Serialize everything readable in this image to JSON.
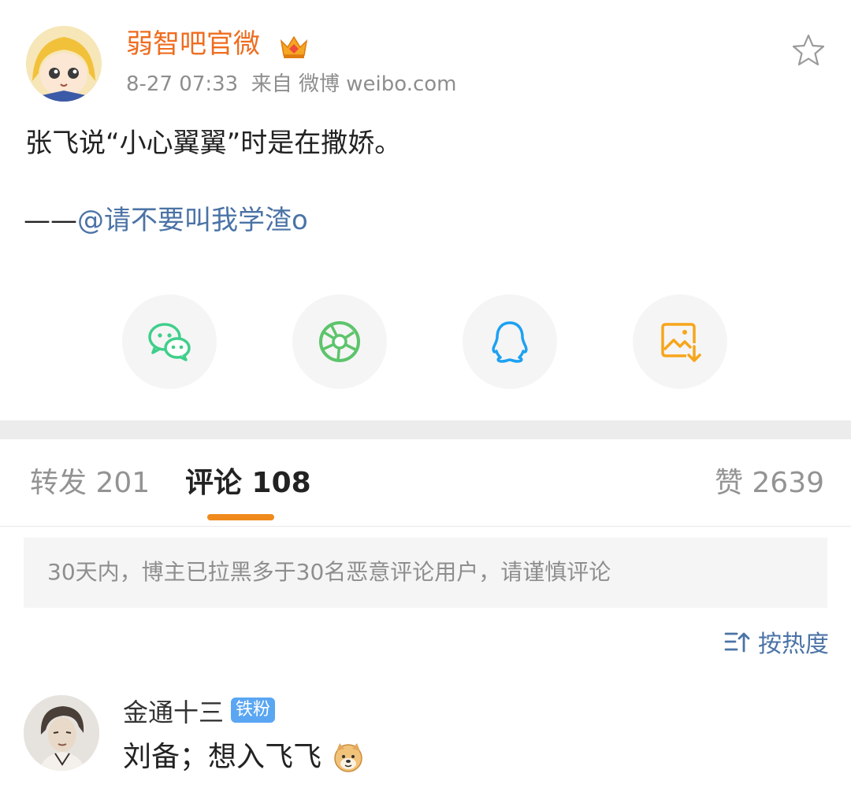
{
  "post": {
    "author": "弱智吧官微",
    "time": "8-27 07:33",
    "source": "来自 微博 weibo.com",
    "text": "张飞说“小心翼翼”时是在撒娇。",
    "byline_dash": "——",
    "byline_mention": "@请不要叫我学渣o"
  },
  "share": {
    "items": [
      {
        "name": "wechat-icon",
        "color": "#3fcf8a"
      },
      {
        "name": "moments-icon",
        "color": "#5dc46b"
      },
      {
        "name": "qq-icon",
        "color": "#1da1f2"
      },
      {
        "name": "save-image-icon",
        "color": "#f7a51b"
      }
    ]
  },
  "tabs": {
    "repost": "转发 201",
    "comments": "评论 108",
    "likes": "赞 2639"
  },
  "notice": "30天内，博主已拉黑多于30名恶意评论用户，请谨慎评论",
  "sort_label": "按热度",
  "comment": {
    "user": "金通十三",
    "badge": "铁粉",
    "text": "刘备；想入飞飞"
  },
  "colors": {
    "author": "#ef6c1f",
    "link": "#4b73a6",
    "tab_indicator": "#f08a1c",
    "badge": "#5aa6f3"
  }
}
